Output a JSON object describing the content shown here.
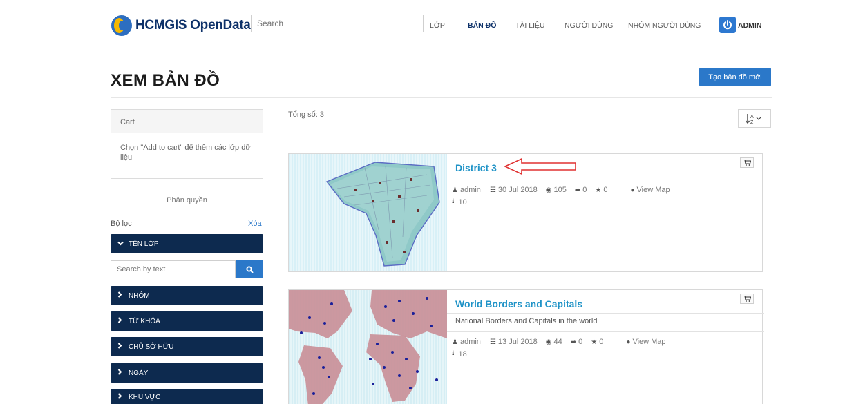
{
  "header": {
    "logo_text": "HCMGIS OpenData",
    "search_placeholder": "Search",
    "nav": [
      "LỚP",
      "BẢN ĐỒ",
      "TÀI LIỆU",
      "NGƯỜI DÙNG",
      "NHÓM NGƯỜI DÙNG"
    ],
    "active_nav": "BẢN ĐỒ",
    "user_label": "ADMIN"
  },
  "page": {
    "title": "XEM BẢN ĐỒ",
    "new_map_button": "Tạo bản đồ mới"
  },
  "sidebar": {
    "cart_title": "Cart",
    "cart_hint": "Chọn \"Add to cart\" để thêm các lớp dữ liệu",
    "permissions_button": "Phân quyền",
    "filters_label": "Bộ lọc",
    "clear_label": "Xóa",
    "search_placeholder": "Search by text",
    "facets": [
      {
        "label": "TÊN LỚP",
        "expanded": true
      },
      {
        "label": "NHÓM",
        "expanded": false
      },
      {
        "label": "TỪ KHÓA",
        "expanded": false
      },
      {
        "label": "CHỦ SỞ HỮU",
        "expanded": false
      },
      {
        "label": "NGÀY",
        "expanded": false
      },
      {
        "label": "KHU VỰC",
        "expanded": false
      }
    ]
  },
  "results": {
    "total_label": "Tổng số: 3",
    "items": [
      {
        "title": "District 3",
        "abstract": "",
        "owner": "admin",
        "date": "30 Jul 2018",
        "views": "105",
        "shares": "0",
        "rating": "0",
        "view_map": "View Map",
        "downloads": "10"
      },
      {
        "title": "World Borders and Capitals",
        "abstract": "National Borders and Capitals in the world",
        "owner": "admin",
        "date": "13 Jul 2018",
        "views": "44",
        "shares": "0",
        "rating": "0",
        "view_map": "View Map",
        "downloads": "18"
      }
    ]
  },
  "colors": {
    "navy": "#0d2a4f",
    "accent_blue": "#2b78c9",
    "title_blue": "#1f93c7",
    "annotation_red": "#e03131"
  }
}
